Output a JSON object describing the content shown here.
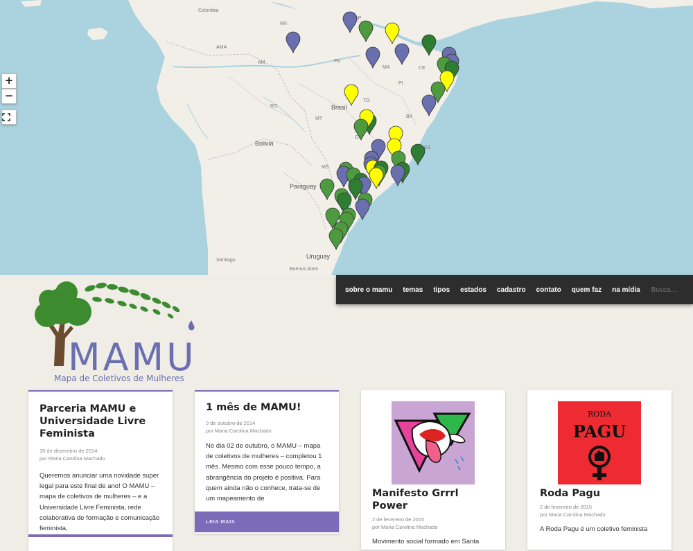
{
  "map": {
    "zoom_in": "+",
    "zoom_out": "−",
    "fullscreen_icon": "fullscreen-icon",
    "labels": {
      "colombia": "Colombia",
      "brasil": "Brasil",
      "bolivia": "Bolivia",
      "paraguay": "Paraguay",
      "uruguay": "Uruguay",
      "santiago": "Santiago",
      "buenos_aires": "Buenos Aires",
      "ama": "AMA",
      "am": "AM",
      "pa": "PA",
      "rr": "RR",
      "ap": "AP",
      "ma": "MA",
      "ce": "CE",
      "pi": "PI",
      "to": "TO",
      "ba": "BA",
      "mt": "MT",
      "ro": "RO",
      "go": "GO",
      "ms": "MS",
      "mg": "MG",
      "es": "ES"
    },
    "marker_colors": {
      "blue": "#6a6fb0",
      "green": "#4e9a3f",
      "dark_green": "#2e7d32",
      "yellow": "#ffff00"
    }
  },
  "nav": {
    "items": [
      "sobre o mamu",
      "temas",
      "tipos",
      "estados",
      "cadastro",
      "contato",
      "quem faz",
      "na mídia"
    ],
    "search_placeholder": "Busca..."
  },
  "logo": {
    "title": "MAMU",
    "subtitle": "Mapa de Coletivos de Mulheres"
  },
  "posts": [
    {
      "title": "Parceria MAMU e Universidade Livre Feminista",
      "date": "10 de dezembro de 2014",
      "author": "por Maria Carolina Machado",
      "excerpt": "Queremos anunciar uma novidade super legal para este final de ano! O MAMU – mapa de coletivos de mulheres – e a Universidade Livre Feminista, rede colaborativa de formação e comunicação feminista,"
    },
    {
      "title": "1 mês de MAMU!",
      "date": "3 de outubro de 2014",
      "author": "por Maria Carolina Machado",
      "excerpt": "No dia 02 de outubro, o MAMU – mapa de coletivos de mulheres – completou 1 mês. Mesmo com esse pouco tempo, a abrangência do projeto é positiva. Para quem ainda não o conhece, trata-se de um mapeamento de",
      "read_more": "LEIA MAIS"
    },
    {
      "title": "Manifesto Grrrl Power",
      "date": "2 de fevereiro de 2015",
      "author": "por Maria Carolina Machado",
      "excerpt": "Movimento social formado em Santa"
    },
    {
      "title": "Roda Pagu",
      "date": "2 de fevereiro de 2015",
      "author": "por Maria Carolina Machado",
      "excerpt": "A Roda Pagu é um coletivo feminista",
      "image_text_top": "RODA",
      "image_text_main": "PAGU"
    }
  ]
}
